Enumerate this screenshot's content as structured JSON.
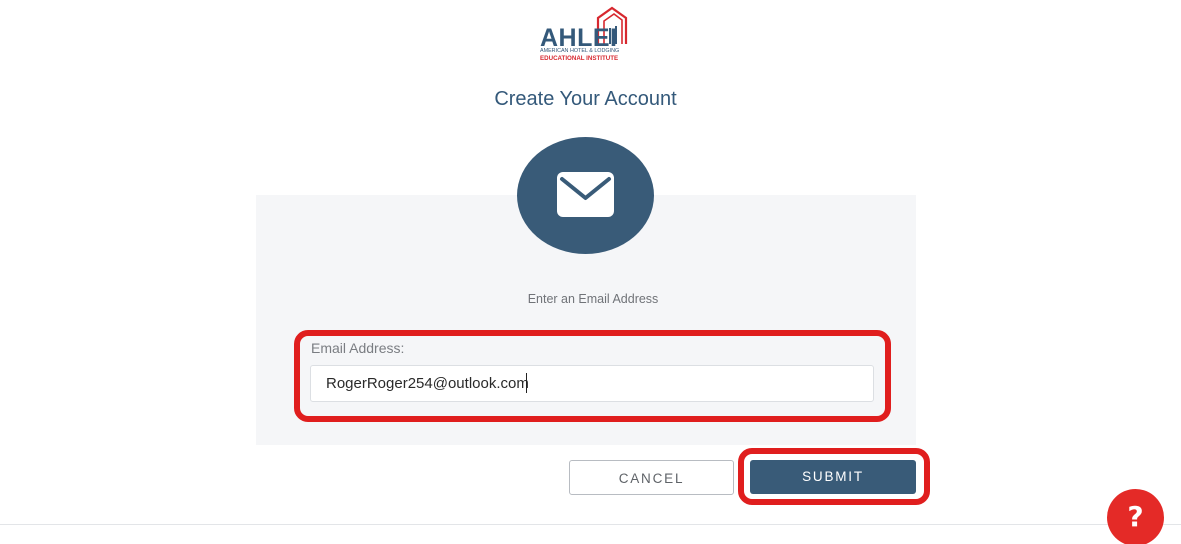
{
  "logo": {
    "wordmark": "AHLEI",
    "line1": "AMERICAN HOTEL & LODGING",
    "line2": "EDUCATIONAL INSTITUTE"
  },
  "page_title": "Create Your Account",
  "hero_icon": "envelope-icon",
  "instruction": "Enter an Email Address",
  "email_field": {
    "label": "Email Address:",
    "value": "RogerRoger254@outlook.com"
  },
  "buttons": {
    "cancel": "CANCEL",
    "submit": "SUBMIT"
  },
  "help": {
    "label": "?",
    "icon": "help-icon"
  },
  "colors": {
    "brand_blue": "#395b78",
    "brand_red": "#d7282f",
    "highlight": "#e01e1e",
    "help_red": "#e42a27"
  }
}
